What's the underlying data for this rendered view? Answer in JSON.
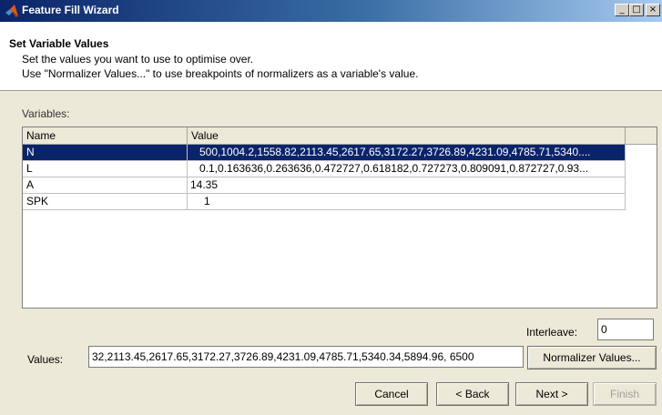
{
  "window": {
    "title": "Feature Fill Wizard",
    "controls": {
      "minimize": "_",
      "maximize": "□",
      "close": "×"
    }
  },
  "header": {
    "title": "Set Variable Values",
    "line1": "Set the values you want to use to optimise over.",
    "line2": "Use \"Normalizer Values...\" to use breakpoints of normalizers as a variable's value."
  },
  "variables": {
    "label": "Variables:",
    "columns": [
      "Name",
      "Value"
    ],
    "rows": [
      {
        "name": "N",
        "value": "500,1004.2,1558.82,2113.45,2617.65,3172.27,3726.89,4231.09,4785.71,5340....",
        "selected": true
      },
      {
        "name": "L",
        "value": "0.1,0.163636,0.263636,0.472727,0.618182,0.727273,0.809091,0.872727,0.93...",
        "selected": false
      },
      {
        "name": "A",
        "value": "14.35",
        "selected": false
      },
      {
        "name": "SPK",
        "value": "1",
        "selected": false
      }
    ]
  },
  "interleave": {
    "label": "Interleave:",
    "value": "0"
  },
  "values_field": {
    "label": "Values:",
    "value": "32,2113.45,2617.65,3172.27,3726.89,4231.09,4785.71,5340.34,5894.96, 6500"
  },
  "buttons": {
    "normalizer": "Normalizer Values...",
    "cancel": "Cancel",
    "back": "< Back",
    "next": "Next >",
    "finish": "Finish"
  },
  "colors": {
    "title_gradient_start": "#0a246a",
    "title_gradient_end": "#a6caf0",
    "selection": "#0a246a",
    "dialog_face": "#ece9d8"
  },
  "icons": {
    "app": "matlab-logo-icon"
  }
}
